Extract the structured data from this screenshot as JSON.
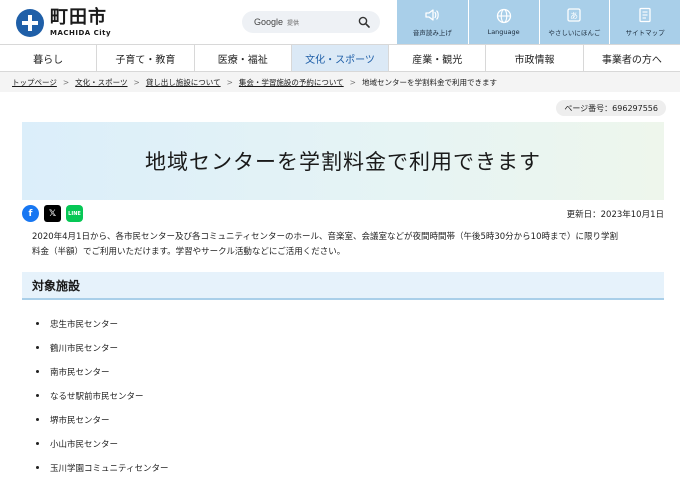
{
  "header": {
    "logo_kanji": "町田市",
    "logo_roman": "MACHIDA City",
    "search": {
      "brand": "Google",
      "sub": "提供"
    },
    "tools": [
      {
        "label": "音声読み上げ",
        "icon": "speaker-icon"
      },
      {
        "label": "Language",
        "icon": "globe-icon"
      },
      {
        "label": "やさしいにほんご",
        "icon": "easy-japanese-icon"
      },
      {
        "label": "サイトマップ",
        "icon": "sitemap-icon"
      }
    ]
  },
  "nav": {
    "items": [
      {
        "label": "暮らし"
      },
      {
        "label": "子育て・教育"
      },
      {
        "label": "医療・福祉"
      },
      {
        "label": "文化・スポーツ"
      },
      {
        "label": "産業・観光"
      },
      {
        "label": "市政情報"
      },
      {
        "label": "事業者の方へ"
      }
    ]
  },
  "breadcrumb": {
    "links": [
      "トップページ",
      "文化・スポーツ",
      "貸し出し施設について",
      "集会・学習施設の予約について"
    ],
    "current": "地域センターを学割料金で利用できます"
  },
  "page_number": "ページ番号：696297556",
  "title": "地域センターを学割料金で利用できます",
  "updated": "更新日：2023年10月1日",
  "intro_line1": "2020年4月1日から、各市民センター及び各コミュニティセンターのホール、音楽室、会議室などが夜間時間帯（午後5時30分から10時まで）に限り学割",
  "intro_line2": "料金（半額）でご利用いただけます。学習やサークル活動などにご活用ください。",
  "section_heading": "対象施設",
  "facilities": [
    "忠生市民センター",
    "鶴川市民センター",
    "南市民センター",
    "なるせ駅前市民センター",
    "堺市民センター",
    "小山市民センター",
    "玉川学園コミュニティセンター"
  ],
  "colors": {
    "accent": "#1f5fa8",
    "tool_bg": "#a9cfe9",
    "nav_active_bg": "#dbe9f6"
  }
}
